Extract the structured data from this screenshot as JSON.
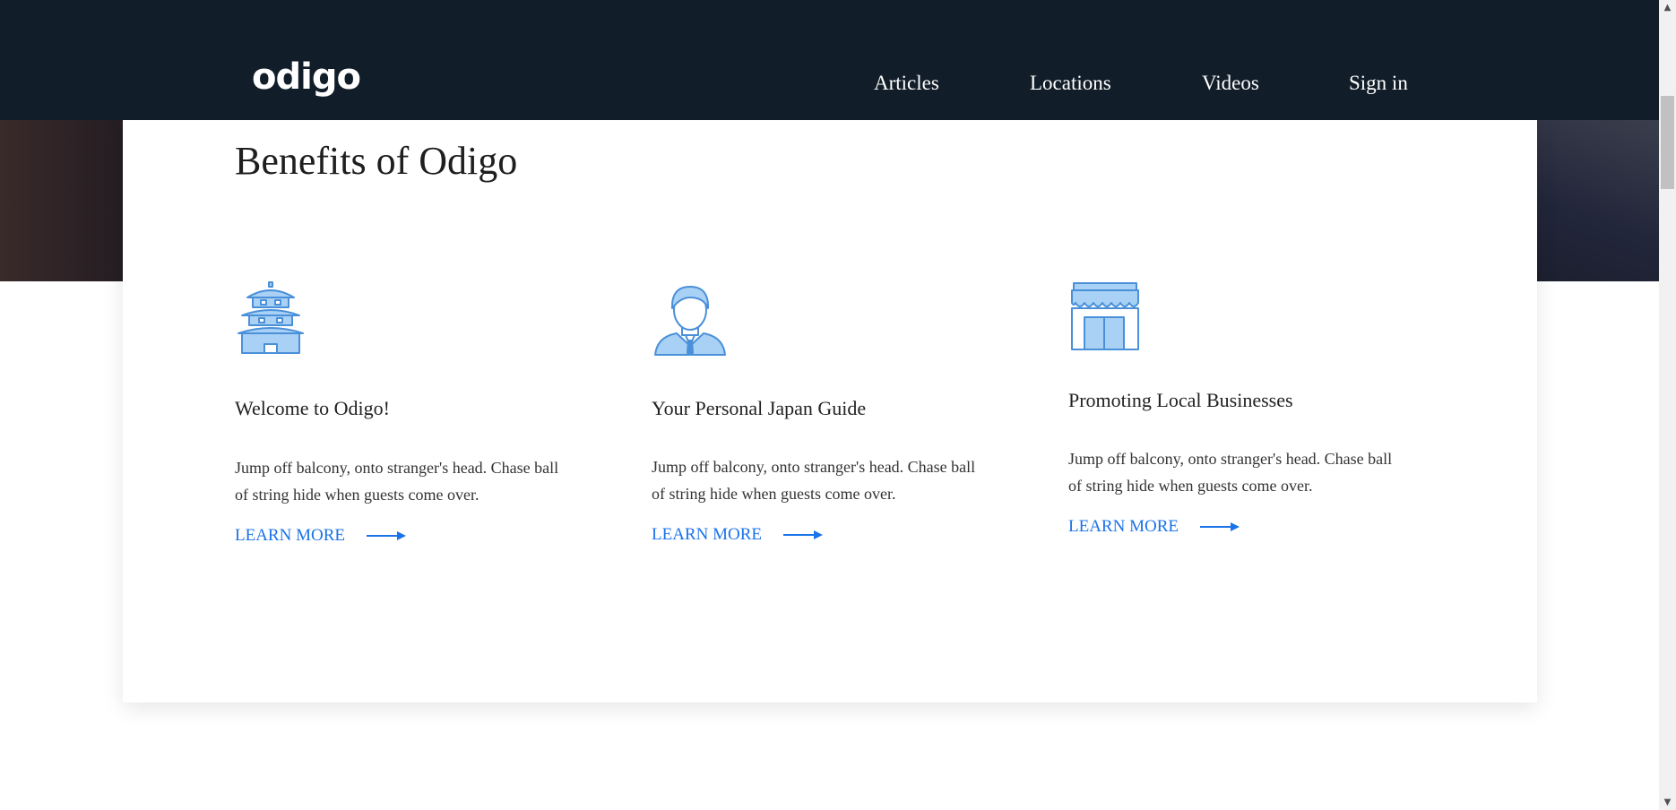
{
  "header": {
    "logo": "odigo",
    "nav": {
      "articles": "Articles",
      "locations": "Locations",
      "videos": "Videos",
      "signin": "Sign in"
    }
  },
  "section": {
    "title": "Benefits of Odigo"
  },
  "features": [
    {
      "icon": "pagoda-icon",
      "title": "Welcome to Odigo!",
      "text": "Jump off balcony, onto stranger's head. Chase ball of string hide when guests come over.",
      "link": "LEARN MORE"
    },
    {
      "icon": "guide-person-icon",
      "title": "Your Personal Japan Guide",
      "text": "Jump off balcony, onto stranger's head. Chase ball of string hide when guests come over.",
      "link": "LEARN MORE"
    },
    {
      "icon": "storefront-icon",
      "title": "Promoting Local Businesses",
      "text": "Jump off balcony, onto stranger's head. Chase ball of string hide when guests come over.",
      "link": "LEARN MORE"
    }
  ],
  "scrollbar": {
    "up_icon": "scroll-up-arrow-icon",
    "down_icon": "scroll-down-arrow-icon"
  },
  "colors": {
    "navbar_bg": "#111d29",
    "accent": "#1a73e8",
    "icon_fill": "#a9d1f5",
    "icon_stroke": "#4a90d9"
  }
}
